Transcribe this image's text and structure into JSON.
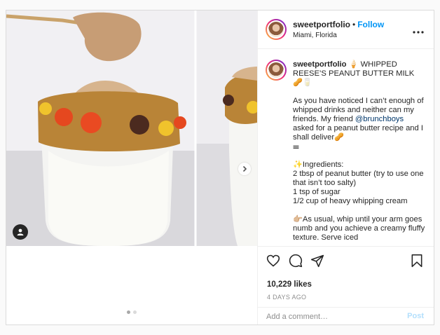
{
  "post": {
    "username": "sweetportfolio",
    "separator": "•",
    "follow_label": "Follow",
    "location": "Miami, Florida",
    "more_label": "•••",
    "caption_username": "sweetportfolio",
    "caption_body": " 🍦 WHIPPED REESE’S PEANUT BUTTER MILK 🥜🥛\n\nAs you have noticed I can’t enough of whipped drinks and neither can my friends. My friend ",
    "mention": "@brunchboys",
    "caption_body_2": " asked for a peanut butter recipe and I shall deliver🥜\n𝍢\n\n✨Ingredients:\n2 tbsp of peanut butter (try to use one that isn’t too salty)\n1 tsp of sugar\n1/2 cup of heavy whipping cream\n\n👉🏼As usual, whip until your arm goes numb and you achieve a creamy fluffy texture. Serve iced",
    "likes": "10,229 likes",
    "date": "4 DAYS AGO",
    "comment_placeholder": "Add a comment…",
    "post_label": "Post"
  },
  "carousel": {
    "slide_count": 2,
    "active_index": 0
  },
  "colors": {
    "link": "#0095f6",
    "post_disabled": "#b2dffc",
    "border": "#dbdbdb"
  },
  "icons": [
    "user-tag-icon",
    "chevron-right-icon",
    "heart-icon",
    "comment-icon",
    "share-icon",
    "save-icon",
    "more-icon"
  ]
}
